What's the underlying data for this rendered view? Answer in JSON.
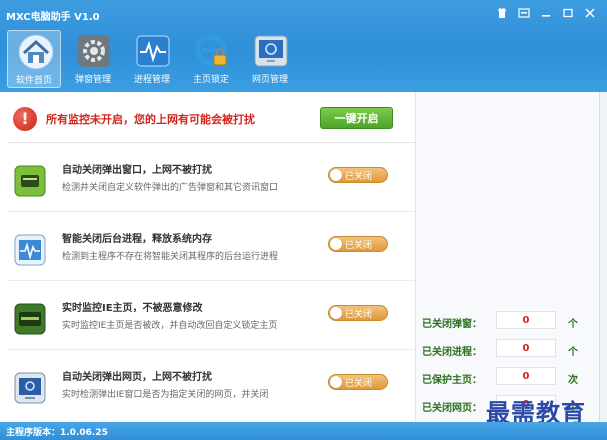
{
  "window": {
    "title": "MXC电脑助手 V1.0",
    "controls": [
      "skin-icon",
      "menu-icon",
      "minimize-icon",
      "maximize-icon",
      "close-icon"
    ]
  },
  "nav": [
    {
      "label": "软件首页",
      "icon": "home-icon",
      "active": true
    },
    {
      "label": "弹窗管理",
      "icon": "gear-icon",
      "active": false
    },
    {
      "label": "进程管理",
      "icon": "pulse-icon",
      "active": false
    },
    {
      "label": "主页锁定",
      "icon": "ie-lock-icon",
      "active": false
    },
    {
      "label": "网页管理",
      "icon": "monitor-icon",
      "active": false
    }
  ],
  "alert": {
    "message": "所有监控未开启，您的上网有可能会被打扰",
    "button": "一键开启"
  },
  "features": [
    {
      "title": "自动关闭弹出窗口，上网不被打扰",
      "desc": "检测并关闭自定义软件弹出的广告弹窗和其它资讯窗口",
      "status": "已关闭",
      "icon": "popup-app-icon"
    },
    {
      "title": "智能关闭后台进程，释放系统内存",
      "desc": "检测到主程序不存在将智能关闭其程序的后台运行进程",
      "status": "已关闭",
      "icon": "process-monitor-icon"
    },
    {
      "title": "实时监控IE主页，不被恶意修改",
      "desc": "实时监控IE主页是否被改，并自动改回自定义锁定主页",
      "status": "已关闭",
      "icon": "ie-homepage-icon"
    },
    {
      "title": "自动关闭弹出网页，上网不被打扰",
      "desc": "实时检测弹出IE窗口是否为指定关闭的网页，并关闭",
      "status": "已关闭",
      "icon": "webpage-icon"
    }
  ],
  "stats": [
    {
      "label": "已关闭弹窗：",
      "value": "0",
      "unit": "个"
    },
    {
      "label": "已关闭进程：",
      "value": "0",
      "unit": "个"
    },
    {
      "label": "已保护主页：",
      "value": "0",
      "unit": "次"
    },
    {
      "label": "已关闭网页：",
      "value": "0",
      "unit": "个"
    }
  ],
  "status_bar": {
    "version": "主程序版本：1.0.06.25"
  },
  "watermark": "最需教育",
  "colors": {
    "header_blue": "#2f8fd8",
    "alert_red": "#d4241b",
    "button_green": "#4ba42a",
    "toggle_orange": "#e0993a",
    "stat_green": "#2e6f1e"
  }
}
